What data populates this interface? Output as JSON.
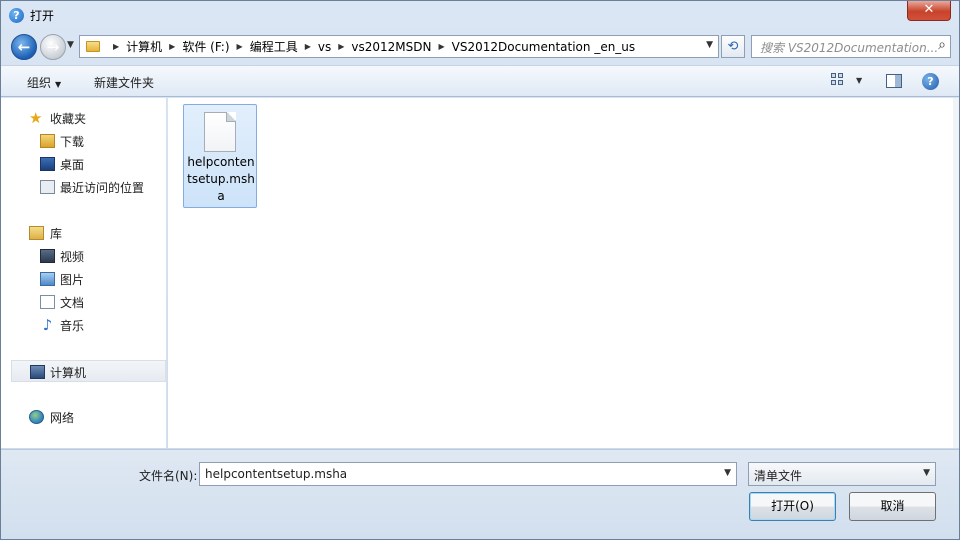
{
  "window": {
    "title": "打开",
    "close_glyph": "✕"
  },
  "nav": {
    "back_glyph": "←",
    "forward_glyph": "→",
    "breadcrumb": [
      "计算机",
      "软件 (F:)",
      "编程工具",
      "vs",
      "vs2012MSDN",
      "VS2012Documentation _en_us"
    ],
    "refresh_glyph": "⟲",
    "search_placeholder": "搜索 VS2012Documentation..."
  },
  "toolbar": {
    "organize_label": "组织",
    "new_folder_label": "新建文件夹",
    "help_glyph": "?"
  },
  "sidebar": {
    "favorites": {
      "label": "收藏夹",
      "items": [
        "下载",
        "桌面",
        "最近访问的位置"
      ]
    },
    "libraries": {
      "label": "库",
      "items": [
        "视频",
        "图片",
        "文档",
        "音乐"
      ]
    },
    "computer": {
      "label": "计算机"
    },
    "network": {
      "label": "网络"
    }
  },
  "files": [
    {
      "name": "helpcontentsetup.msha"
    }
  ],
  "bottom": {
    "filename_label": "文件名(N):",
    "filename_value": "helpcontentsetup.msha",
    "filetype_value": "清单文件",
    "open_label": "打开(O)",
    "cancel_label": "取消"
  }
}
